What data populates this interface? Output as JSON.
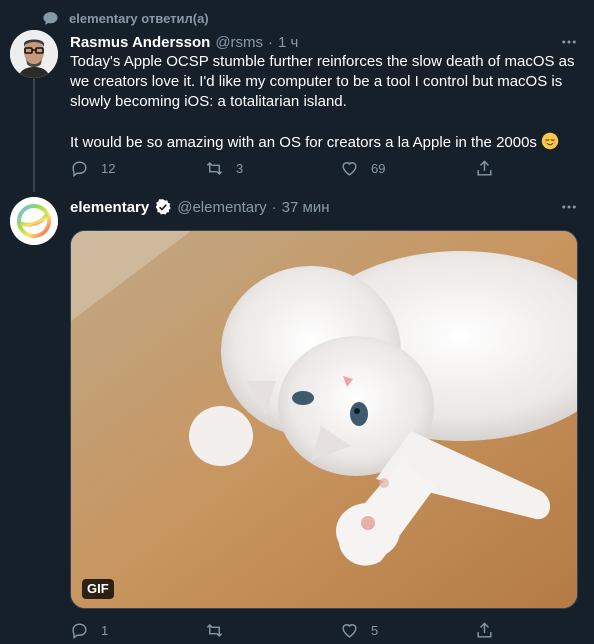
{
  "context": {
    "icon": "chat-bubble-icon",
    "text": "elementary ответил(а)"
  },
  "tweets": [
    {
      "display_name": "Rasmus Andersson",
      "handle": "@rsms",
      "separator": "·",
      "time": "1 ч",
      "text_p1": "Today's Apple OCSP stumble further reinforces the slow death of macOS as we creators love it. I'd like my computer to be a tool I control but macOS is slowly becoming iOS: a totalitarian island.",
      "text_p2": "It would be so amazing with an OS for creators a la Apple in the 2000s",
      "emoji": "relieved-face-emoji",
      "replies": "12",
      "retweets": "3",
      "likes": "69",
      "shares": ""
    },
    {
      "display_name": "elementary",
      "verified": true,
      "handle": "@elementary",
      "separator": "·",
      "time": "37 мин",
      "media_badge": "GIF",
      "replies": "1",
      "retweets": "",
      "likes": "5",
      "shares": ""
    }
  ],
  "colors": {
    "background": "#15202b",
    "muted": "#8899a6",
    "border": "#38444d",
    "verified": "#ffffff"
  }
}
